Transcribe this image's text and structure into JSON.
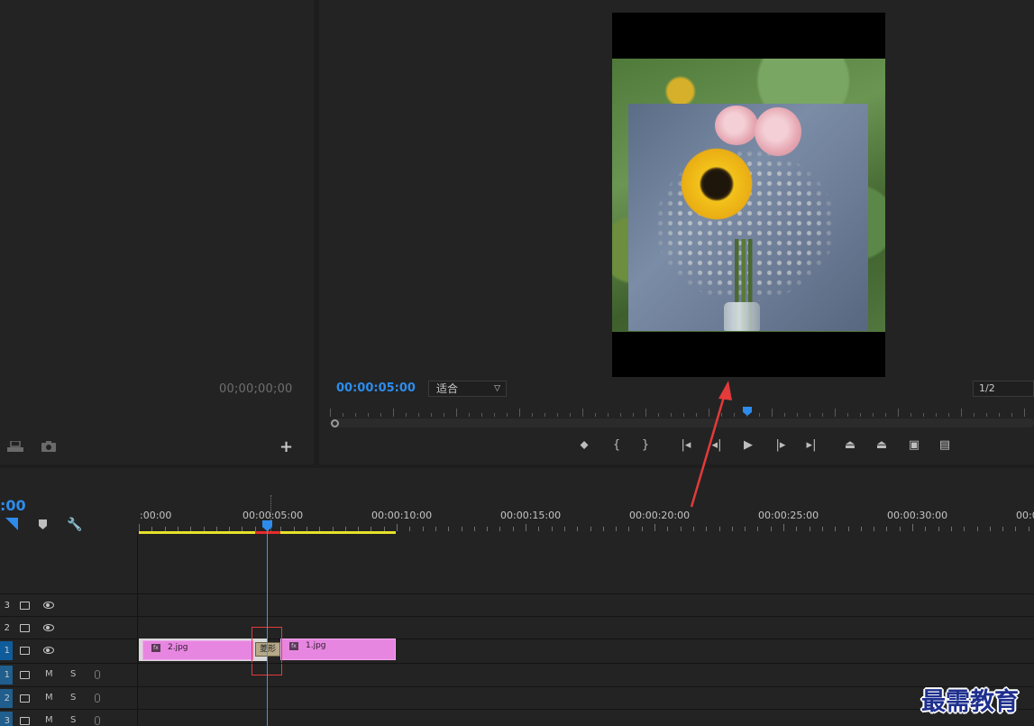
{
  "source_monitor": {
    "timecode": "00;00;00;00",
    "icons": [
      "export-frame-icon",
      "camera-icon"
    ],
    "add_button": "+"
  },
  "program_monitor": {
    "timecode": "00:00:05:00",
    "fit_value": "适合",
    "resolution_value": "1/2",
    "transport": {
      "marker": "⬥",
      "mark_in": "{",
      "mark_out": "}",
      "go_to_in": "|◂",
      "step_back": "◂|",
      "play": "▶",
      "step_forward": "|▸",
      "go_to_out": "▸|",
      "lift": "⏏",
      "extract": "⏏",
      "export_frame": "▣",
      "compare": "▤"
    }
  },
  "timeline": {
    "timecode": ":00",
    "ruler_labels": [
      ":00:00",
      "00:00:05:00",
      "00:00:10:00",
      "00:00:15:00",
      "00:00:20:00",
      "00:00:25:00",
      "00:00:30:00",
      "00:0"
    ],
    "tracks": {
      "v3": "3",
      "v2": "2",
      "v1": "1",
      "a1": "1",
      "a2": "2",
      "a3": "3"
    },
    "mute_label": "M",
    "solo_label": "S",
    "clips": [
      {
        "label": "2.jpg"
      },
      {
        "label": "1.jpg"
      }
    ],
    "transition_label": "菱形",
    "fx_badge": "fx"
  },
  "watermark": "最需教育",
  "colors": {
    "accent_blue": "#2d8ceb",
    "clip_pink": "#e786e0",
    "work_area_yellow": "#e6e12b",
    "annotation_red": "#e33a3a",
    "watermark_blue": "#1e2f8e"
  }
}
